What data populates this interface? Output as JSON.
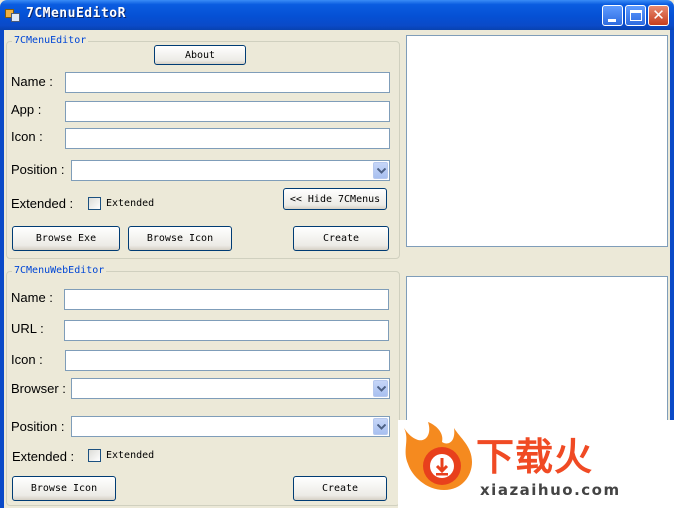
{
  "window": {
    "title": "7CMenuEditoR",
    "controls": {
      "minimize": "minimize-icon",
      "maximize": "maximize-icon",
      "close": "close-icon"
    }
  },
  "menu_editor": {
    "legend": "7CMenuEditor",
    "about_button": "About",
    "name_label": "Name :",
    "app_label": "App :",
    "icon_label": "Icon :",
    "position_label": "Position :",
    "extended_label": "Extended  :",
    "extended_checkbox": "Extended",
    "hide_button": "<< Hide 7CMenus",
    "browse_exe_button": "Browse Exe",
    "browse_icon_button": "Browse Icon",
    "create_button": "Create"
  },
  "web_editor": {
    "legend": "7CMenuWebEditor",
    "name_label": "Name :",
    "url_label": "URL :",
    "icon_label": "Icon :",
    "browser_label": "Browser :",
    "position_label": "Position :",
    "extended_label": "Extended  :",
    "extended_checkbox": "Extended",
    "browse_icon_button": "Browse Icon",
    "create_button": "Create"
  },
  "watermark": {
    "brand": "下载火",
    "url": "xiazaihuo.com",
    "accent": "#f04a24"
  }
}
